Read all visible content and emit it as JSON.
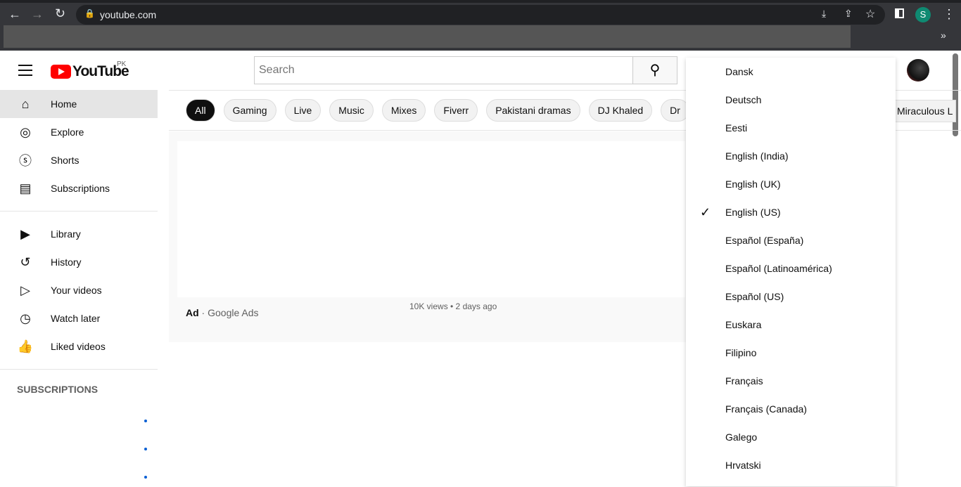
{
  "browser": {
    "url": "youtube.com",
    "profile_initial": "S"
  },
  "header": {
    "logo_text": "YouTube",
    "region": "PK",
    "search_placeholder": "Search"
  },
  "sidebar": {
    "items": [
      {
        "label": "Home",
        "icon": "home-icon",
        "active": true
      },
      {
        "label": "Explore",
        "icon": "compass-icon"
      },
      {
        "label": "Shorts",
        "icon": "shorts-icon"
      },
      {
        "label": "Subscriptions",
        "icon": "subscriptions-icon"
      },
      {
        "label": "Library",
        "icon": "library-icon"
      },
      {
        "label": "History",
        "icon": "history-icon"
      },
      {
        "label": "Your videos",
        "icon": "your-videos-icon"
      },
      {
        "label": "Watch later",
        "icon": "clock-icon"
      },
      {
        "label": "Liked videos",
        "icon": "thumbs-up-icon"
      }
    ],
    "subscriptions_heading": "SUBSCRIPTIONS"
  },
  "chips": [
    "All",
    "Gaming",
    "Live",
    "Music",
    "Mixes",
    "Fiverr",
    "Pakistani dramas",
    "DJ Khaled",
    "Dr",
    "Miraculous L"
  ],
  "ad": {
    "label": "Ad",
    "source": "Google Ads",
    "views": "10K views • 2 days ago"
  },
  "language_menu": {
    "selected": "English (US)",
    "items": [
      "Dansk",
      "Deutsch",
      "Eesti",
      "English (India)",
      "English (UK)",
      "English (US)",
      "Español (España)",
      "Español (Latinoamérica)",
      "Español (US)",
      "Euskara",
      "Filipino",
      "Français",
      "Français (Canada)",
      "Galego",
      "Hrvatski"
    ]
  }
}
